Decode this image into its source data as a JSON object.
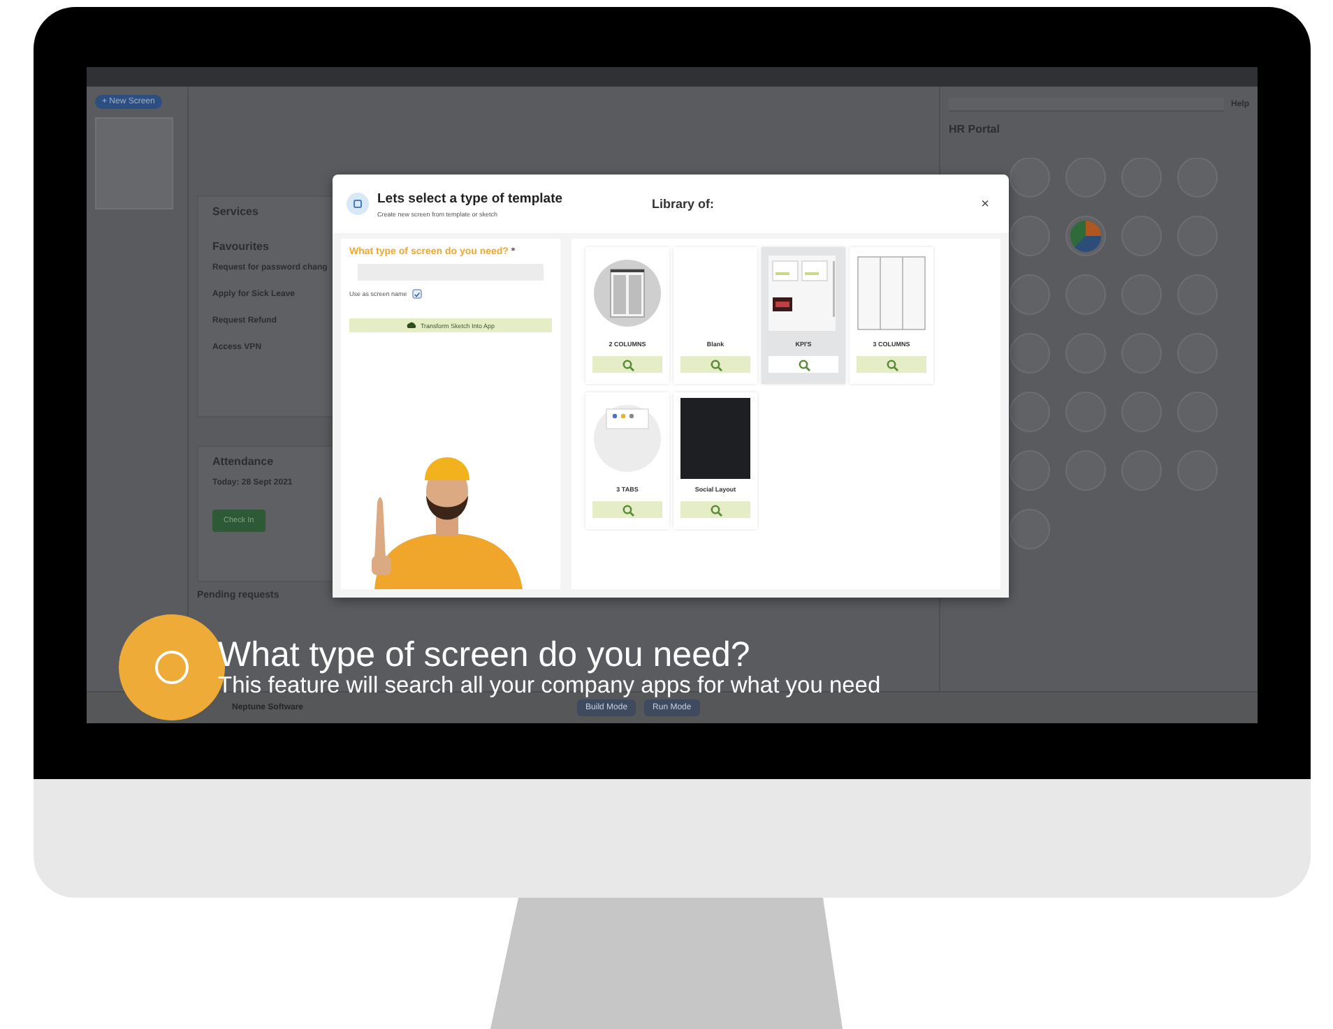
{
  "app": {
    "new_screen": "+ New Screen",
    "services": {
      "title": "Services",
      "section": "Favourites",
      "items": [
        "Request for password chang",
        "Apply for Sick Leave",
        "Request Refund",
        "Access VPN"
      ]
    },
    "attendance": {
      "title": "Attendance",
      "date": "Today: 28 Sept 2021",
      "buttons": [
        "Check In"
      ]
    },
    "pending": {
      "title": "Pending requests"
    },
    "side_panel": {
      "title": "HR Portal",
      "help": "Help"
    },
    "footer": {
      "company": "Neptune Software",
      "modes": [
        "Build Mode",
        "Run Mode"
      ]
    }
  },
  "modal": {
    "title": "Lets select a type of template",
    "subtitle": "Create new screen from template or sketch",
    "library": "Library of:",
    "close": "×",
    "question": "What type of screen do you need?",
    "required": "*",
    "use_as_name": {
      "label": "Use as screen name",
      "checked": true
    },
    "transform": "Transform Sketch Into App",
    "templates": [
      {
        "label": "2 COLUMNS",
        "kind": "two-columns",
        "selected": false
      },
      {
        "label": "Blank",
        "kind": "blank",
        "selected": false
      },
      {
        "label": "KPI'S",
        "kind": "kpis",
        "selected": true
      },
      {
        "label": "3 COLUMNS",
        "kind": "three-columns",
        "selected": false
      },
      {
        "label": "3 TABS",
        "kind": "three-tabs",
        "selected": false
      },
      {
        "label": "Social Layout",
        "kind": "social",
        "selected": false
      }
    ]
  },
  "caption": {
    "title": "What type of screen do you need?",
    "subtitle": "This feature will search all your company apps for what you need"
  }
}
